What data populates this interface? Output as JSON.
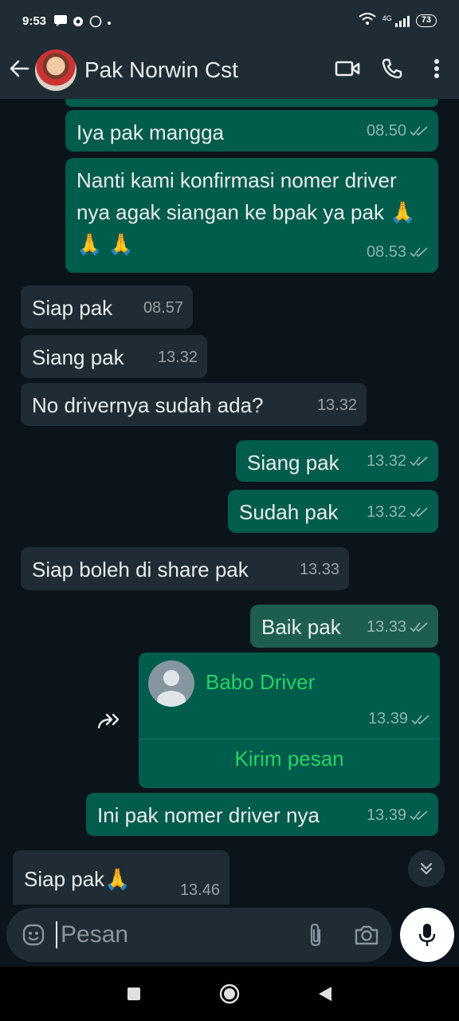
{
  "status": {
    "time": "9:53",
    "network": "4G",
    "battery": "73"
  },
  "header": {
    "contact_name": "Pak Norwin Cst"
  },
  "messages": [
    {
      "dir": "out",
      "text": "Iya pak mangga",
      "time": "08.50"
    },
    {
      "dir": "out",
      "text": "Nanti kami konfirmasi nomer driver nya agak siangan ke bpak ya pak 🙏 🙏 🙏",
      "time": "08.53"
    },
    {
      "dir": "in",
      "text": "Siap pak",
      "time": "08.57"
    },
    {
      "dir": "in",
      "text": "Siang pak",
      "time": "13.32"
    },
    {
      "dir": "in",
      "text": "No drivernya sudah ada?",
      "time": "13.32"
    },
    {
      "dir": "out",
      "text": "Siang pak",
      "time": "13.32"
    },
    {
      "dir": "out",
      "text": "Sudah pak",
      "time": "13.32"
    },
    {
      "dir": "in",
      "text": "Siap boleh di share pak",
      "time": "13.33"
    },
    {
      "dir": "out",
      "text": "Baik pak",
      "time": "13.33"
    },
    {
      "dir": "out",
      "text": "Ini pak nomer driver nya",
      "time": "13.39"
    },
    {
      "dir": "in",
      "text": "Siap pak🙏",
      "time": "13.46"
    }
  ],
  "contact_card": {
    "name": "Babo Driver",
    "time": "13.39",
    "action": "Kirim pesan"
  },
  "composer": {
    "placeholder": "Pesan"
  },
  "colors": {
    "outgoing_bubble": "#005c4b",
    "incoming_bubble": "#1f2c34",
    "accent_green": "#25d366",
    "background": "#0b141a"
  },
  "icons": [
    "back-arrow-icon",
    "video-call-icon",
    "phone-icon",
    "more-options-icon",
    "emoji-icon",
    "attach-icon",
    "camera-icon",
    "mic-icon",
    "forward-icon",
    "scroll-down-icon",
    "nav-recents-icon",
    "nav-home-icon",
    "nav-back-icon"
  ]
}
